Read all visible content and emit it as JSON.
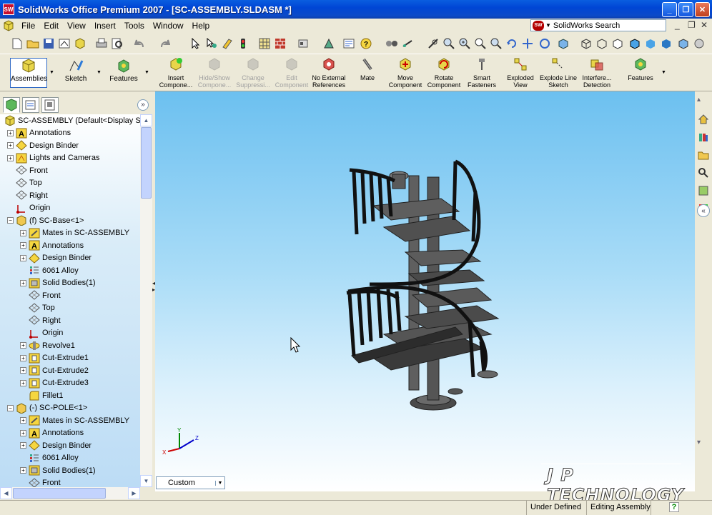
{
  "window": {
    "title": "SolidWorks Office Premium 2007 - [SC-ASSEMBLY.SLDASM *]",
    "controls": [
      "minimize-icon",
      "restore-icon",
      "close-icon"
    ]
  },
  "menubar": {
    "items": [
      "File",
      "Edit",
      "View",
      "Insert",
      "Tools",
      "Window",
      "Help"
    ],
    "search_label": "SolidWorks Search",
    "search_logo": "SW"
  },
  "command_manager": {
    "tabs": [
      {
        "label": "Assemblies",
        "icon": "assemblies-icon"
      },
      {
        "label": "Sketch",
        "icon": "sketch-icon"
      },
      {
        "label": "Features",
        "icon": "features-icon"
      }
    ],
    "commands": [
      {
        "label": "Insert Compone...",
        "icon": "insert-component-icon",
        "enabled": true
      },
      {
        "label": "Hide/Show Compone...",
        "icon": "hide-show-icon",
        "enabled": false
      },
      {
        "label": "Change Suppressi...",
        "icon": "suppress-icon",
        "enabled": false
      },
      {
        "label": "Edit Component",
        "icon": "edit-component-icon",
        "enabled": false
      },
      {
        "label": "No External References",
        "icon": "no-external-references-icon",
        "enabled": true
      },
      {
        "label": "Mate",
        "icon": "mate-icon",
        "enabled": true
      },
      {
        "label": "Move Component",
        "icon": "move-component-icon",
        "enabled": true
      },
      {
        "label": "Rotate Component",
        "icon": "rotate-component-icon",
        "enabled": true
      },
      {
        "label": "Smart Fasteners",
        "icon": "smart-fasteners-icon",
        "enabled": true
      },
      {
        "label": "Exploded View",
        "icon": "exploded-view-icon",
        "enabled": true
      },
      {
        "label": "Explode Line Sketch",
        "icon": "explode-line-sketch-icon",
        "enabled": true
      },
      {
        "label": "Interfere... Detection",
        "icon": "interference-detection-icon",
        "enabled": true
      },
      {
        "label": "Features",
        "icon": "features-icon",
        "enabled": true
      }
    ]
  },
  "feature_tree": {
    "items": [
      {
        "label": "SC-ASSEMBLY  (Default<Display Sta",
        "icon": "assembly-icon",
        "level": 0,
        "exp": ""
      },
      {
        "label": "Annotations",
        "icon": "annotations-icon",
        "level": 1,
        "exp": "+"
      },
      {
        "label": "Design Binder",
        "icon": "design-binder-icon",
        "level": 1,
        "exp": "+"
      },
      {
        "label": "Lights and Cameras",
        "icon": "lights-cameras-icon",
        "level": 1,
        "exp": "+"
      },
      {
        "label": "Front",
        "icon": "plane-icon",
        "level": 1,
        "exp": ""
      },
      {
        "label": "Top",
        "icon": "plane-icon",
        "level": 1,
        "exp": ""
      },
      {
        "label": "Right",
        "icon": "plane-icon",
        "level": 1,
        "exp": ""
      },
      {
        "label": "Origin",
        "icon": "origin-icon",
        "level": 1,
        "exp": ""
      },
      {
        "label": "(f) SC-Base<1>",
        "icon": "part-icon",
        "level": 1,
        "exp": "−"
      },
      {
        "label": "Mates in SC-ASSEMBLY",
        "icon": "mates-icon",
        "level": 2,
        "exp": "+"
      },
      {
        "label": "Annotations",
        "icon": "annotations-icon",
        "level": 2,
        "exp": "+"
      },
      {
        "label": "Design Binder",
        "icon": "design-binder-icon",
        "level": 2,
        "exp": "+"
      },
      {
        "label": "6061 Alloy",
        "icon": "material-icon",
        "level": 2,
        "exp": ""
      },
      {
        "label": "Solid Bodies(1)",
        "icon": "solid-bodies-icon",
        "level": 2,
        "exp": "+"
      },
      {
        "label": "Front",
        "icon": "plane-icon",
        "level": 2,
        "exp": ""
      },
      {
        "label": "Top",
        "icon": "plane-icon",
        "level": 2,
        "exp": ""
      },
      {
        "label": "Right",
        "icon": "plane-icon",
        "level": 2,
        "exp": ""
      },
      {
        "label": "Origin",
        "icon": "origin-icon",
        "level": 2,
        "exp": ""
      },
      {
        "label": "Revolve1",
        "icon": "revolve-icon",
        "level": 2,
        "exp": "+"
      },
      {
        "label": "Cut-Extrude1",
        "icon": "cut-extrude-icon",
        "level": 2,
        "exp": "+"
      },
      {
        "label": "Cut-Extrude2",
        "icon": "cut-extrude-icon",
        "level": 2,
        "exp": "+"
      },
      {
        "label": "Cut-Extrude3",
        "icon": "cut-extrude-icon",
        "level": 2,
        "exp": "+"
      },
      {
        "label": "Fillet1",
        "icon": "fillet-icon",
        "level": 2,
        "exp": ""
      },
      {
        "label": "(-) SC-POLE<1>",
        "icon": "part-icon",
        "level": 1,
        "exp": "−"
      },
      {
        "label": "Mates in SC-ASSEMBLY",
        "icon": "mates-icon",
        "level": 2,
        "exp": "+"
      },
      {
        "label": "Annotations",
        "icon": "annotations-icon",
        "level": 2,
        "exp": "+"
      },
      {
        "label": "Design Binder",
        "icon": "design-binder-icon",
        "level": 2,
        "exp": "+"
      },
      {
        "label": "6061 Alloy",
        "icon": "material-icon",
        "level": 2,
        "exp": ""
      },
      {
        "label": "Solid Bodies(1)",
        "icon": "solid-bodies-icon",
        "level": 2,
        "exp": "+"
      },
      {
        "label": "Front",
        "icon": "plane-icon",
        "level": 2,
        "exp": ""
      }
    ]
  },
  "viewport": {
    "view_orientation": "Custom",
    "watermark": "J P TECHNOLOGY",
    "triad": {
      "x": "X",
      "y": "Y",
      "z": "Z"
    }
  },
  "statusbar": {
    "state": "Under Defined",
    "mode": "Editing Assembly",
    "help_icon": "?"
  },
  "colors": {
    "titlebar": "#0046d5",
    "viewport_top": "#6cc0f0",
    "viewport_bottom": "#ffffff",
    "tree_bg": "#bcdcf5"
  }
}
